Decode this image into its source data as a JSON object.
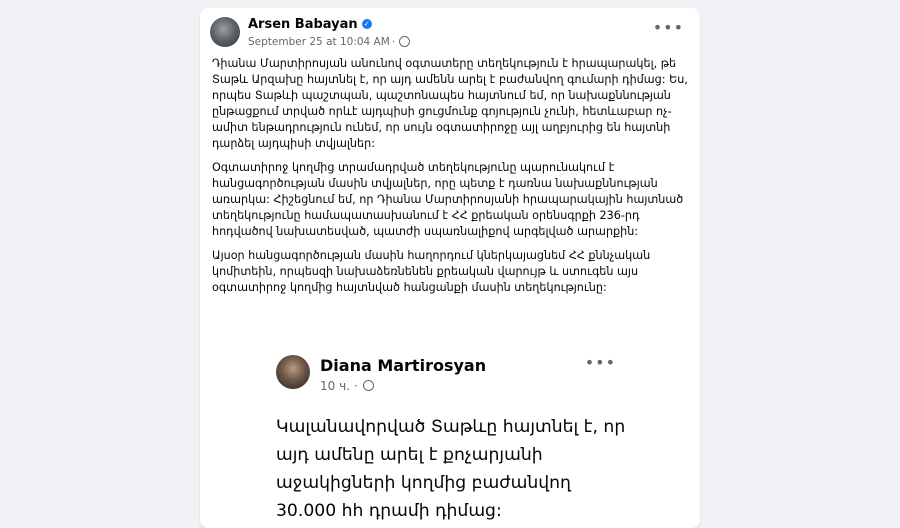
{
  "post": {
    "author": "Arsen Babayan",
    "verified_icon": "verified-badge-icon",
    "timestamp": "September 25 at 10:04 AM",
    "separator": "·",
    "privacy_icon": "globe-icon",
    "more": "•••",
    "paragraphs": [
      "Դիանա Մարտիրոսյան անունով օգտատերը տեղեկություն է հրապարակել, թե Տաթև Արզախը հայտնել է, որ այդ ամենն արել է բաժանվող գումարի դիմաց: Ես, որպես Տաթևի պաշտպան, պաշտոնապես հայտնում եմ, որ նախաքննության ընթացքում տրված որևէ այդպիսի ցուցմունք գոյություն չունի, հետևաբար ոչ­ամիտ ենթադրություն ունեմ, որ սույն օգտատիրոջը այլ աղբյուրից են հայտնի դարձել այդպիսի տվյալներ:",
      "Օգտատիրոջ կողմից տրամադրված տեղեկությունը պարունակում է հանցագործության մասին տվյալներ, որը պետք է դառնա նախաքննության առարկա: Հիշեցնում եմ, որ Դիանա Մարտիրոսյանի հրապարակային հայտնած տեղեկությունը համապատասխանում է ՀՀ քրեական օրենսգրքի 236-րդ հոդվածով նախատեսված, պատժի սպառնալիքով արգելված արարքին:",
      "Այսօր հանցագործության մասին հաղորդում կներկայացնեմ ՀՀ քննչական կոմիտեին, որպեսզի նախաձեռնենեն քրեական վարույթ և ստուգեն այս օգտատիրոջ կողմից հայտնված հանցանքի մասին տեղեկությունը:"
    ]
  },
  "shared_post": {
    "author": "Diana Martirosyan",
    "time": "10 ч.",
    "separator": "·",
    "privacy_icon": "globe-icon",
    "more": "•••",
    "text": "Կալանավորված Տաթևը  հայտնել է, որ այդ ամենը արել է քոչարյանի աջակիցների կողմից բաժանվող 30.000 հհ դրամի դիմաց:"
  }
}
